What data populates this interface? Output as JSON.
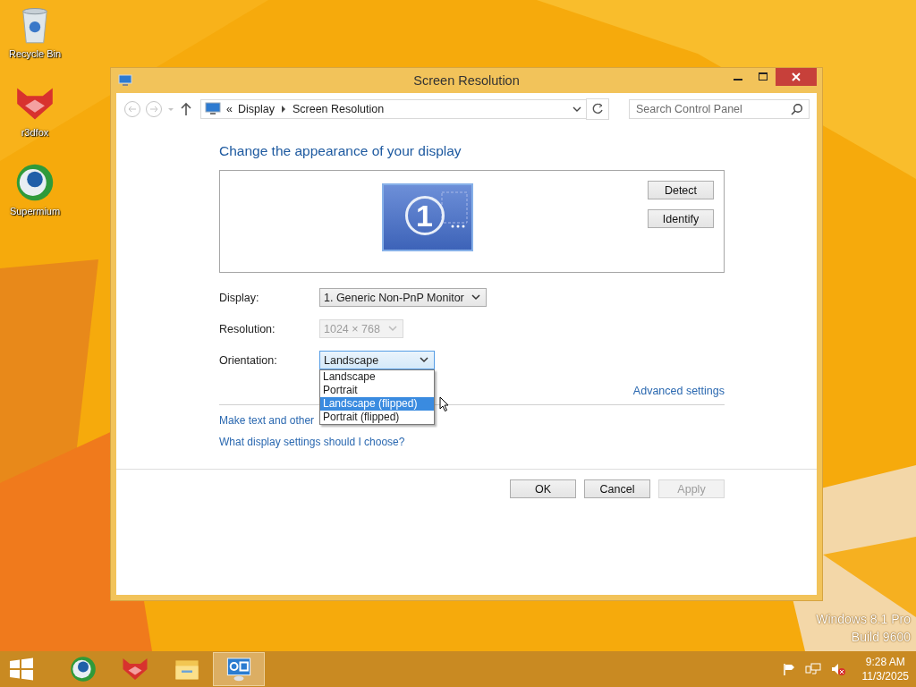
{
  "desktop": {
    "icons": [
      {
        "label": "Recycle Bin",
        "kind": "bin"
      },
      {
        "label": "r3dfox",
        "kind": "fox"
      },
      {
        "label": "Supermium",
        "kind": "globe"
      }
    ],
    "edition": "Windows 8.1 Pro",
    "build": "Build 9600"
  },
  "window": {
    "title": "Screen Resolution",
    "address": {
      "overflow": "«",
      "crumbs": [
        "Display",
        "Screen Resolution"
      ]
    },
    "search": {
      "placeholder": "Search Control Panel"
    },
    "heading": "Change the appearance of your display",
    "preview": {
      "monitor": "1",
      "buttons": [
        "Detect",
        "Identify"
      ]
    },
    "fields": [
      {
        "label": "Display:",
        "value": "1. Generic Non-PnP Monitor",
        "disabled": false,
        "open": false
      },
      {
        "label": "Resolution:",
        "value": "1024 × 768",
        "disabled": true,
        "open": false
      },
      {
        "label": "Orientation:",
        "value": "Landscape",
        "disabled": false,
        "open": true
      }
    ],
    "dropdown": {
      "options": [
        {
          "label": "Landscape",
          "selected": false
        },
        {
          "label": "Portrait",
          "selected": false
        },
        {
          "label": "Landscape (flipped)",
          "selected": true
        },
        {
          "label": "Portrait (flipped)",
          "selected": false
        }
      ]
    },
    "advanced_link": "Advanced settings",
    "links": [
      "Make text and other",
      "What display settings should I choose?"
    ],
    "buttons": [
      {
        "label": "OK",
        "disabled": false
      },
      {
        "label": "Cancel",
        "disabled": false
      },
      {
        "label": "Apply",
        "disabled": true
      }
    ]
  },
  "taskbar": {
    "apps": [
      {
        "kind": "globe",
        "selected": false
      },
      {
        "kind": "fox",
        "selected": false
      },
      {
        "kind": "folder",
        "selected": false
      },
      {
        "kind": "control-panel",
        "selected": true
      }
    ],
    "time": "9:28 AM",
    "date": "11/3/2025"
  }
}
